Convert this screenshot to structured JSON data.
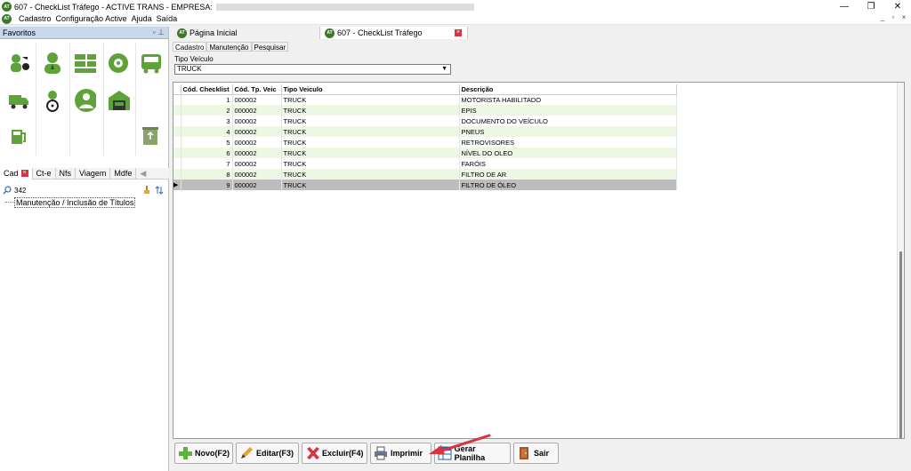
{
  "window": {
    "title": "607 - CheckList Tráfego - ACTIVE TRANS - EMPRESA:",
    "app_icon_text": "AT",
    "minimize": "—",
    "restore": "❐",
    "close": "✕"
  },
  "menu": {
    "items": [
      "Cadastro",
      "Configuração Active",
      "Ajuda",
      "Saída"
    ],
    "mdi": [
      "_",
      "▫",
      "×"
    ]
  },
  "favorites": {
    "title": "Favoritos",
    "tabs": [
      "Cad",
      "Ct-e",
      "Nfs",
      "Viagem",
      "Mdfe"
    ],
    "search_value": "342",
    "tree_item": "Manutenção / Inclusão de Títulos"
  },
  "main_tabs": [
    "Página Inicial",
    "607 - CheckList Tráfego"
  ],
  "sub_tabs": [
    "Cadastro",
    "Manutenção",
    "Pesquisar"
  ],
  "form": {
    "tipo_label": "Tipo Veículo",
    "tipo_value": "TRUCK"
  },
  "grid": {
    "columns": [
      "Cód. Checklist",
      "Cód. Tp. Veic",
      "Tipo Veiculo",
      "Descrição"
    ],
    "rows": [
      [
        "1",
        "000002",
        "TRUCK",
        "MOTORISTA HABILITADO"
      ],
      [
        "2",
        "000002",
        "TRUCK",
        "EPIS"
      ],
      [
        "3",
        "000002",
        "TRUCK",
        "DOCUMENTO DO VEÍCULO"
      ],
      [
        "4",
        "000002",
        "TRUCK",
        "PNEUS"
      ],
      [
        "5",
        "000002",
        "TRUCK",
        "RETROVISORES"
      ],
      [
        "6",
        "000002",
        "TRUCK",
        "NÍVEL DO OLEO"
      ],
      [
        "7",
        "000002",
        "TRUCK",
        "FARÓIS"
      ],
      [
        "8",
        "000002",
        "TRUCK",
        "FILTRO DE AR"
      ],
      [
        "9",
        "000002",
        "TRUCK",
        "FILTRO DE ÓLEO"
      ]
    ],
    "selected_row": 9
  },
  "buttons": {
    "novo": "Novo(F2)",
    "editar": "Editar(F3)",
    "excluir": "Excluir(F4)",
    "imprimir": "Imprimir",
    "gerar": "Gerar Planilha",
    "sair": "Sair"
  },
  "colors": {
    "accent_green": "#5fa23a",
    "row_alt": "#eef7e4",
    "row_selected": "#bdbdbd",
    "arrow_red": "#d9333f"
  }
}
